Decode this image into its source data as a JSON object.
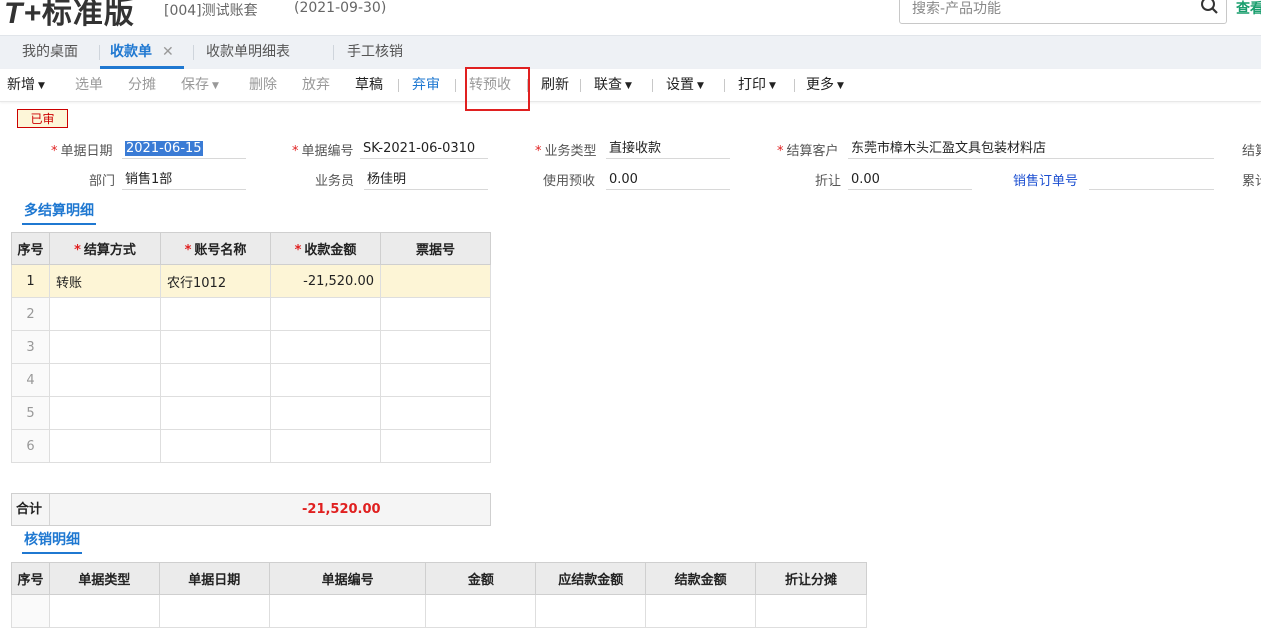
{
  "header": {
    "logo_mark": "T+",
    "logo_text": "标准版",
    "account": "[004]测试账套",
    "date": "(2021-09-30)",
    "search_placeholder": "搜索-产品功能",
    "view_link": "查看"
  },
  "tabs": [
    {
      "label": "我的桌面",
      "active": false
    },
    {
      "label": "收款单",
      "active": true,
      "close": "✕"
    },
    {
      "label": "收款单明细表",
      "active": false
    },
    {
      "label": "手工核销",
      "active": false
    }
  ],
  "toolbar": {
    "new": "新增",
    "select": "选单",
    "split": "分摊",
    "save": "保存",
    "delete": "删除",
    "abandon": "放弃",
    "draft": "草稿",
    "unaudit": "弃审",
    "to_prepay": "转预收",
    "refresh": "刷新",
    "link_query": "联查",
    "settings": "设置",
    "print": "打印",
    "more": "更多"
  },
  "status_badge": "已审",
  "form": {
    "date_label": "单据日期",
    "date_value": "2021-06-15",
    "code_label": "单据编号",
    "code_value": "SK-2021-06-0310",
    "biztype_label": "业务类型",
    "biztype_value": "直接收款",
    "customer_label": "结算客户",
    "customer_value": "东莞市樟木头汇盈文具包装材料店",
    "settle_label_cut": "结算",
    "dept_label": "部门",
    "dept_value": "销售1部",
    "salesman_label": "业务员",
    "salesman_value": "杨佳明",
    "prepay_label": "使用预收",
    "prepay_value": "0.00",
    "discount_label": "折让",
    "discount_value": "0.00",
    "order_link": "销售订单号",
    "accum_label_cut": "累计"
  },
  "settlement": {
    "title": "多结算明细",
    "columns": [
      "序号",
      "结算方式",
      "账号名称",
      "收款金额",
      "票据号"
    ],
    "rows": [
      [
        "1",
        "转账",
        "农行1012",
        "-21,520.00",
        ""
      ],
      [
        "2",
        "",
        "",
        "",
        ""
      ],
      [
        "3",
        "",
        "",
        "",
        ""
      ],
      [
        "4",
        "",
        "",
        "",
        ""
      ],
      [
        "5",
        "",
        "",
        "",
        ""
      ],
      [
        "6",
        "",
        "",
        "",
        ""
      ]
    ],
    "total_label": "合计",
    "total_value": "-21,520.00"
  },
  "writeoff": {
    "title": "核销明细",
    "columns": [
      "序号",
      "单据类型",
      "单据日期",
      "单据编号",
      "金额",
      "应结款金额",
      "结款金额",
      "折让分摊"
    ]
  },
  "colors": {
    "accent": "#1f78d1",
    "negative": "#e02020",
    "active_row": "#fdf5d6",
    "highlight": "#e02020"
  }
}
